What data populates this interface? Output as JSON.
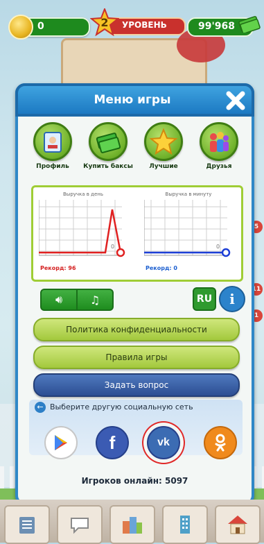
{
  "topbar": {
    "coins": "0",
    "level_number": "2",
    "level_label": "УРОВЕНЬ",
    "money": "99'968"
  },
  "side_badges": [
    "5",
    "11",
    "1"
  ],
  "menu": {
    "title": "Меню игры",
    "items": [
      {
        "label": "Профиль",
        "icon": "profile-icon"
      },
      {
        "label": "Купить баксы",
        "icon": "cash-icon"
      },
      {
        "label": "Лучшие",
        "icon": "star-icon"
      },
      {
        "label": "Друзья",
        "icon": "friends-icon"
      }
    ],
    "charts": [
      {
        "title": "Выручка в день",
        "record_label": "Рекорд: 96",
        "zero_label": "0",
        "line_color": "#e02020"
      },
      {
        "title": "Выручка в минуту",
        "record_label": "Рекорд: 0",
        "zero_label": "0",
        "line_color": "#1c3ed6"
      }
    ],
    "language": "RU",
    "buttons": {
      "privacy": "Политика конфиденциальности",
      "rules": "Правила игры",
      "ask": "Задать вопрос"
    },
    "social": {
      "header": "Выберите другую социальную сеть",
      "networks": [
        "google-play-icon",
        "facebook-icon",
        "vk-icon",
        "odnoklassniki-icon"
      ]
    },
    "online": "Игроков онлайн: 5097"
  },
  "colors": {
    "panel_border": "#2f88c7",
    "accent_green": "#9fcd35",
    "vk_highlight": "#e02828"
  }
}
